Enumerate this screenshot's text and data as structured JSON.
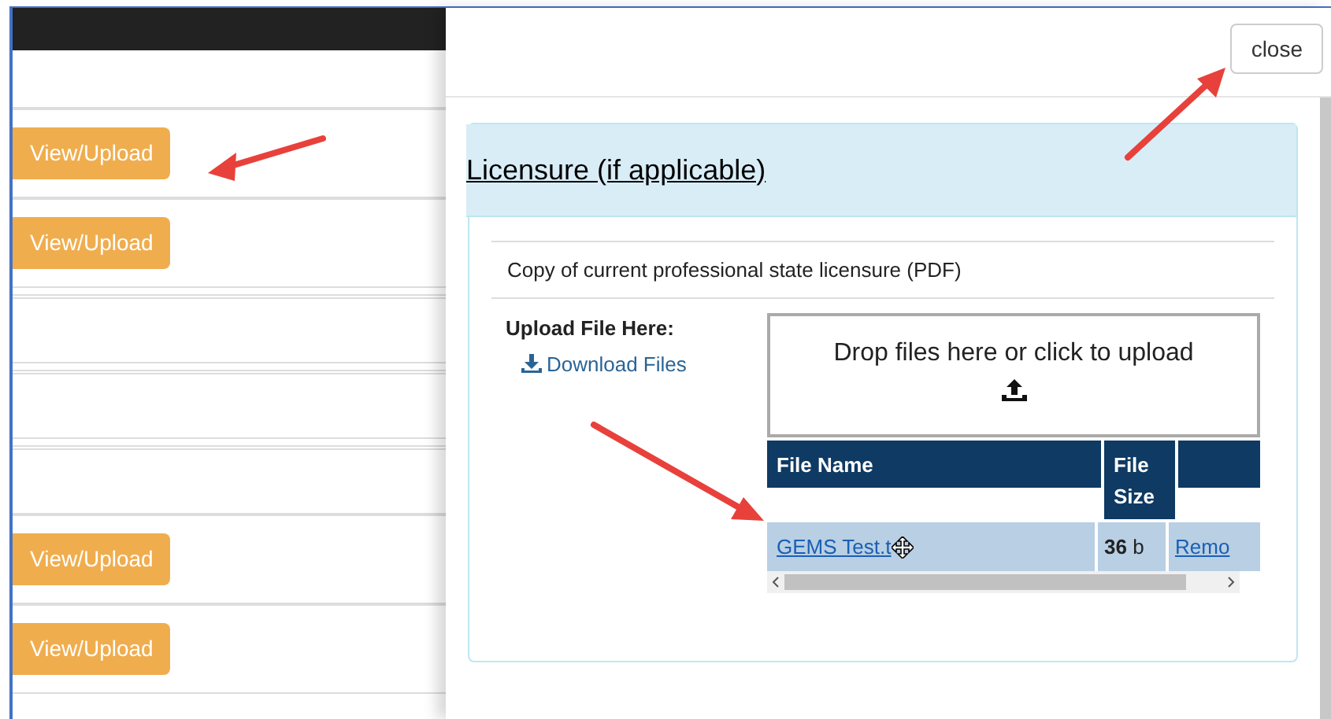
{
  "left_page": {
    "rows": [
      {
        "kind": "upload",
        "button": "View/Upload"
      },
      {
        "kind": "upload",
        "button": "View/Upload"
      },
      {
        "kind": "blank"
      },
      {
        "kind": "blank"
      },
      {
        "kind": "blank"
      },
      {
        "kind": "upload",
        "button": "View/Upload"
      },
      {
        "kind": "upload",
        "button": "View/Upload"
      }
    ]
  },
  "modal": {
    "close_button": "close",
    "panel": {
      "heading": "Licensure (if applicable)",
      "description": "Copy of current professional state licensure (PDF)",
      "upload_label": "Upload File Here:",
      "download_link": "Download Files",
      "dropzone": "Drop files here or click to upload",
      "table": {
        "columns": [
          "File Name",
          "File Size"
        ],
        "rows": [
          {
            "name": "GEMS Test.t",
            "size": "**36** b",
            "action": "Remo",
            "selected": true
          }
        ]
      }
    }
  }
}
